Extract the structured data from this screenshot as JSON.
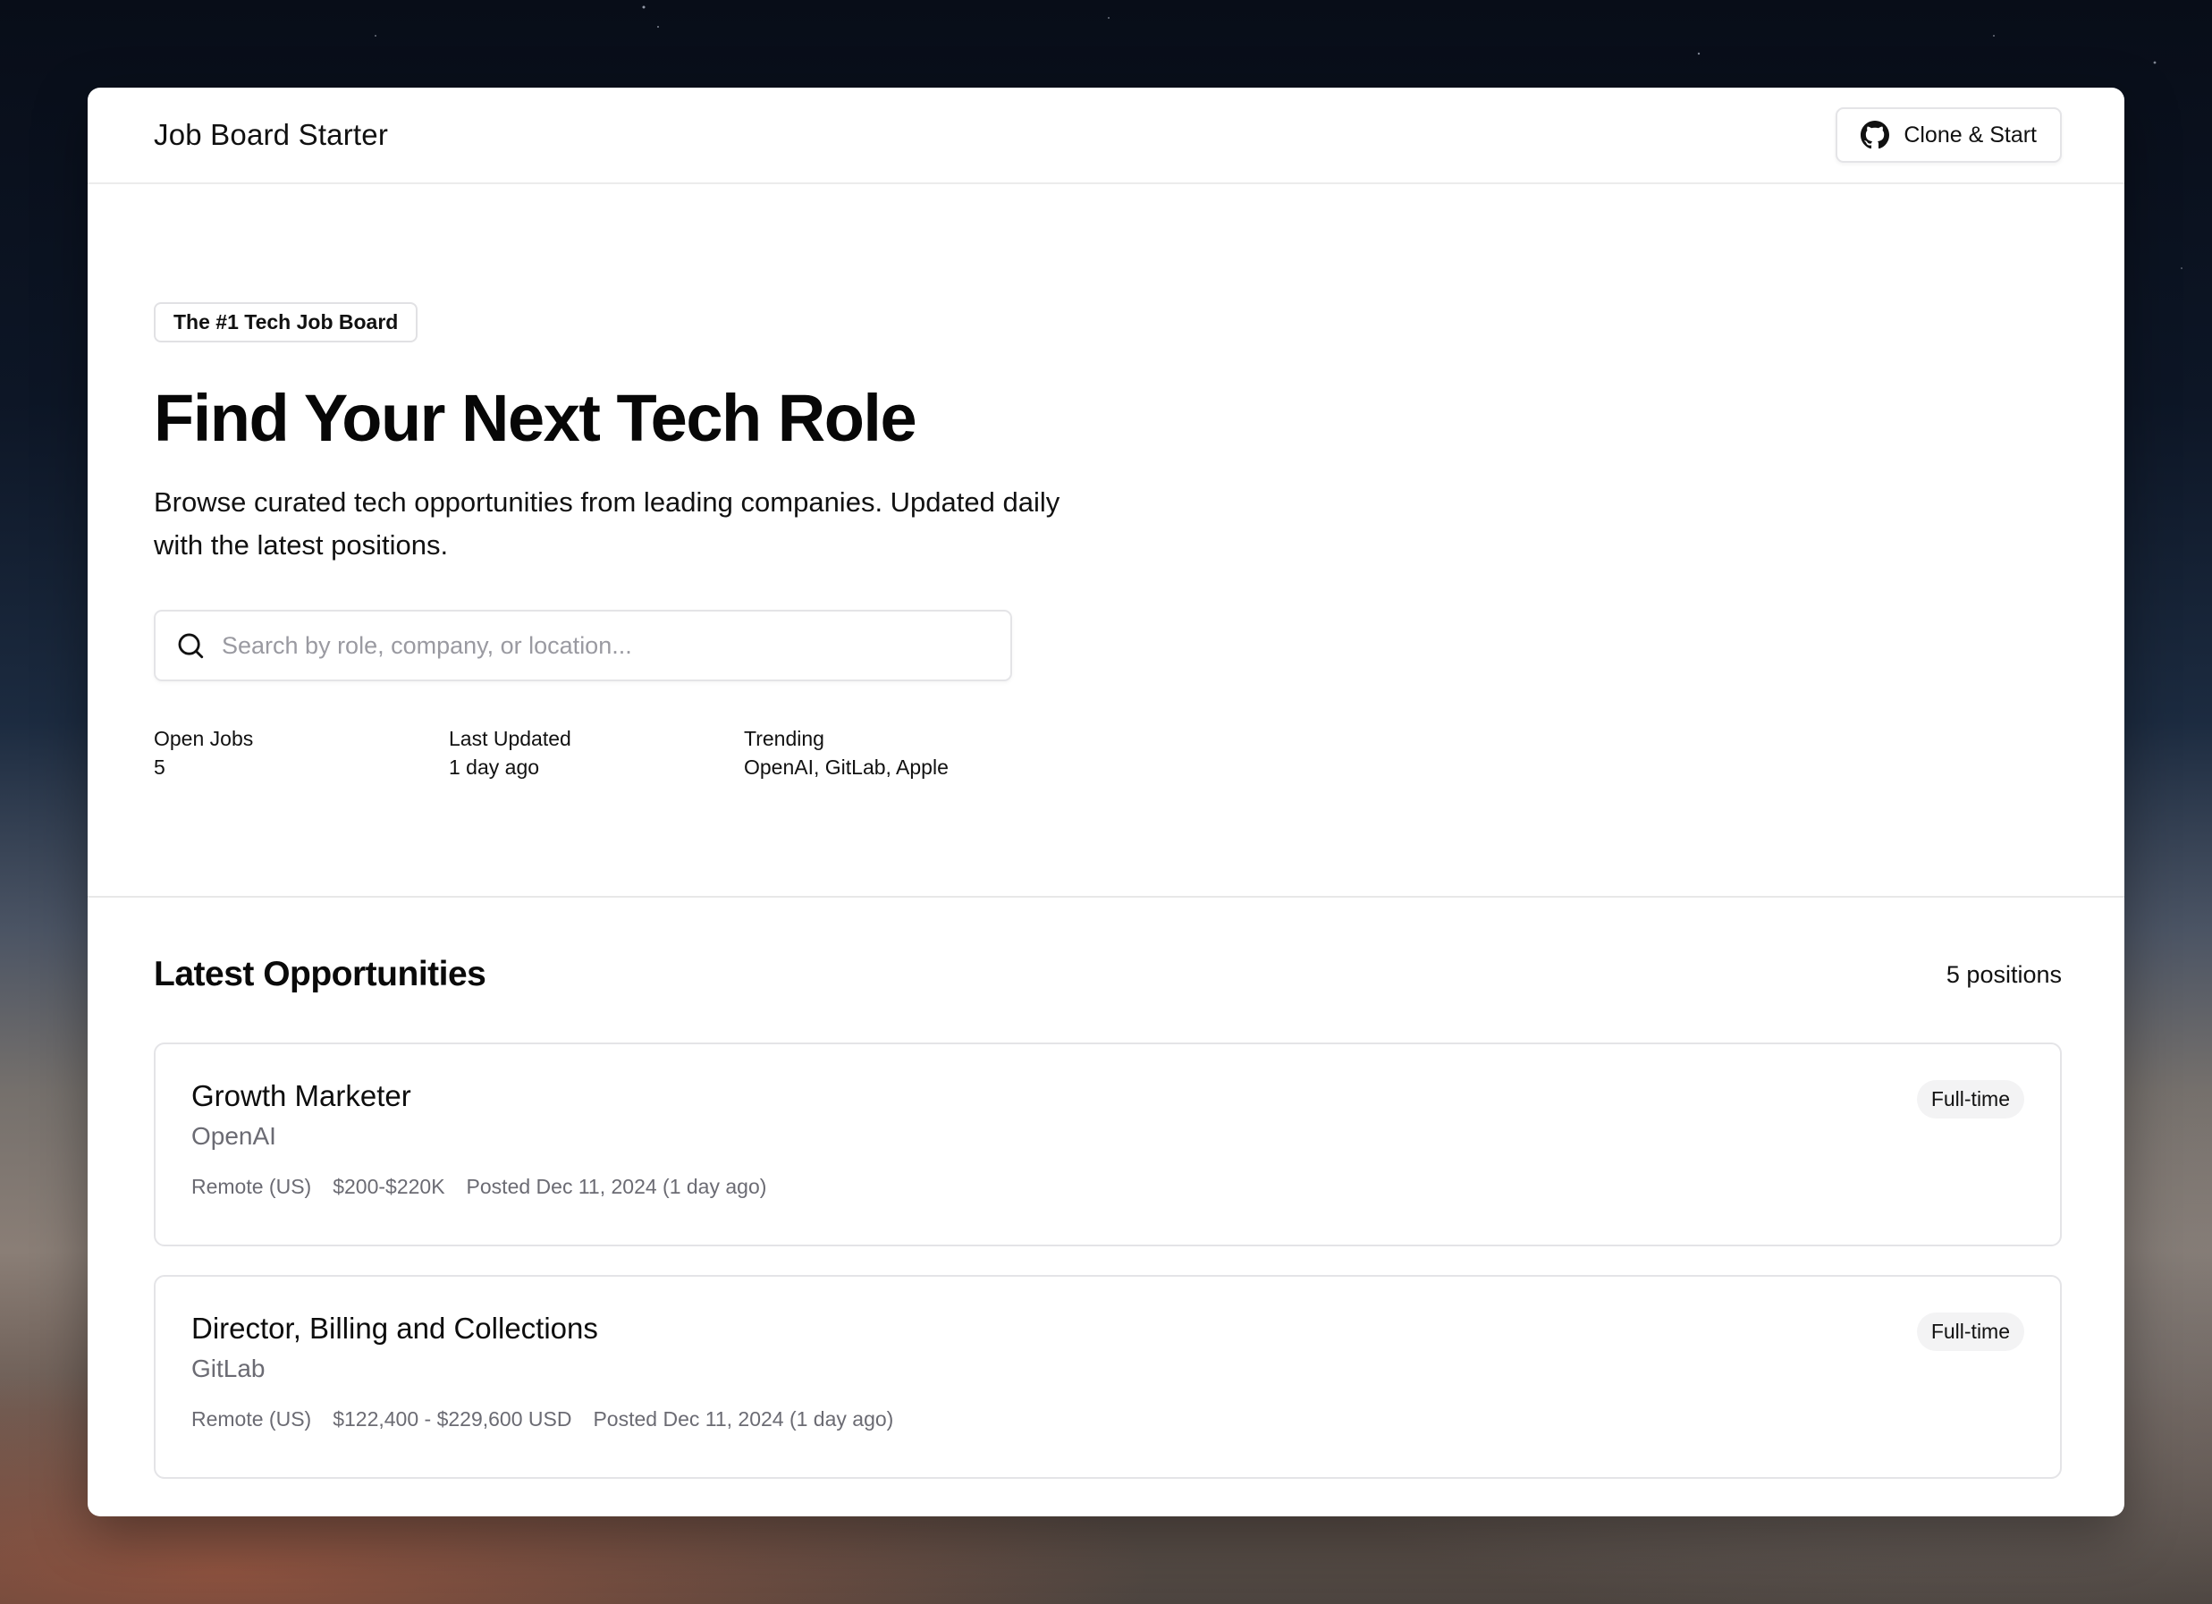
{
  "header": {
    "brand": "Job Board Starter",
    "clone_label": "Clone & Start",
    "clone_icon": "github-icon"
  },
  "hero": {
    "badge": "The #1 Tech Job Board",
    "title": "Find Your Next Tech Role",
    "subtitle": "Browse curated tech opportunities from leading companies. Updated daily with the latest positions.",
    "search": {
      "placeholder": "Search by role, company, or location...",
      "value": "",
      "icon": "search-icon"
    },
    "stats": [
      {
        "label": "Open Jobs",
        "value": "5"
      },
      {
        "label": "Last Updated",
        "value": "1 day ago"
      },
      {
        "label": "Trending",
        "value": "OpenAI, GitLab, Apple"
      }
    ]
  },
  "listing": {
    "title": "Latest Opportunities",
    "count": "5 positions",
    "jobs": [
      {
        "title": "Growth Marketer",
        "company": "OpenAI",
        "location": "Remote (US)",
        "salary": "$200-$220K",
        "posted": "Posted Dec 11, 2024 (1 day ago)",
        "type": "Full-time"
      },
      {
        "title": "Director, Billing and Collections",
        "company": "GitLab",
        "location": "Remote (US)",
        "salary": "$122,400 - $229,600 USD",
        "posted": "Posted Dec 11, 2024 (1 day ago)",
        "type": "Full-time"
      }
    ]
  },
  "colors": {
    "text": "#0a0a0a",
    "muted": "#6b6b73",
    "border": "#e4e4e7",
    "pill_bg": "#f3f3f4"
  }
}
